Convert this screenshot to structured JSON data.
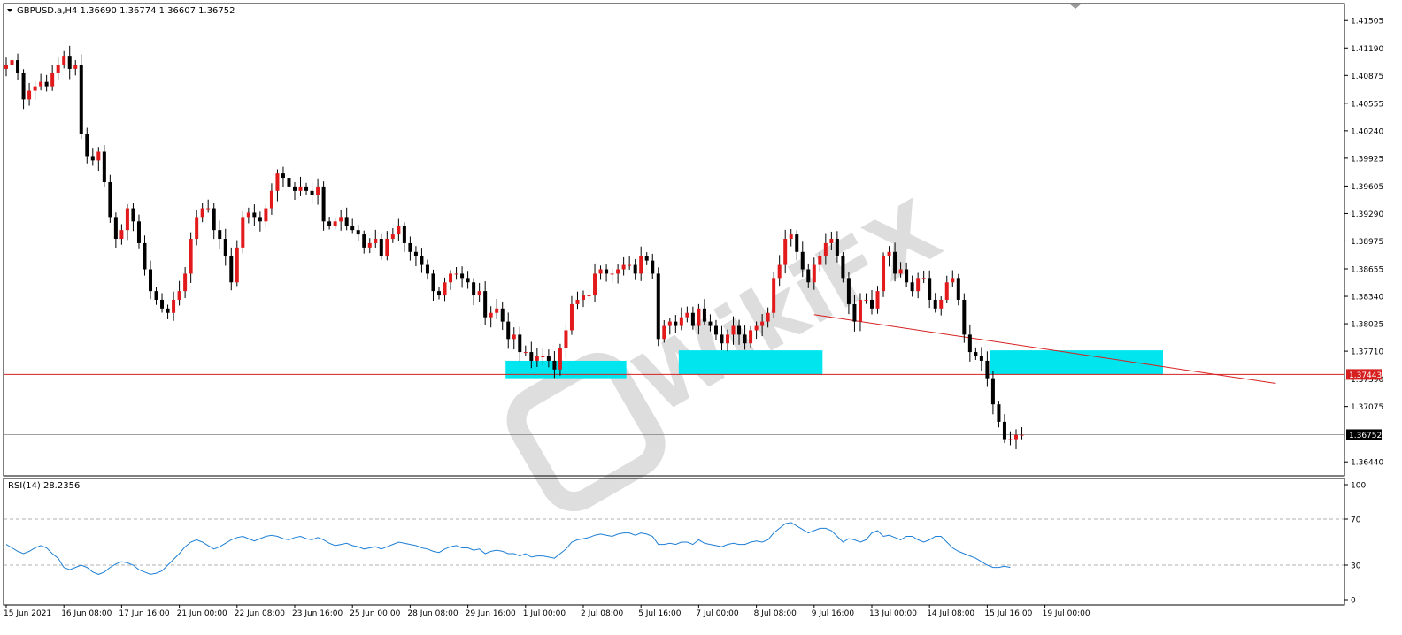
{
  "header": {
    "symbol_line": "GBPUSD.a,H4  1.36690 1.36774 1.36607 1.36752"
  },
  "rsi_panel": {
    "label": "RSI(14) 28.2356",
    "line_color": "#1e7fd6"
  },
  "colors": {
    "bull": "#e31a1c",
    "bear": "#000000",
    "zone": "#00e5ee",
    "hline": "#d62020",
    "trendline": "#d62020",
    "price_tag_bg": "#000000",
    "hline_tag_bg": "#d62020"
  },
  "watermark": {
    "text": "WikiFX",
    "icon": "wikifx-logo-icon"
  },
  "chart_data": [
    {
      "type": "candlestick",
      "symbol": "GBPUSD.a",
      "timeframe": "H4",
      "ohlc_header": {
        "open": 1.3669,
        "high": 1.36774,
        "low": 1.36607,
        "close": 1.36752
      },
      "y_ticks": [
        "1.41505",
        "1.41190",
        "1.40875",
        "1.40555",
        "1.40240",
        "1.39925",
        "1.39605",
        "1.39290",
        "1.38975",
        "1.38655",
        "1.38340",
        "1.38025",
        "1.37710",
        "1.37390",
        "1.37075",
        "1.36752",
        "1.36440"
      ],
      "ylim": [
        1.363,
        1.4168
      ],
      "current_price": {
        "value": 1.36752,
        "label": "1.36752"
      },
      "horizontal_line": {
        "value": 1.37443,
        "label": "1.37443"
      },
      "trendline": {
        "from": {
          "bar": 140,
          "price": 1.3813
        },
        "to": {
          "bar": 220,
          "price": 1.3734
        }
      },
      "zones": [
        {
          "from_bar": 87,
          "to_bar": 107,
          "price_top": 1.376,
          "price_bottom": 1.374
        },
        {
          "from_bar": 117,
          "to_bar": 141,
          "price_top": 1.3772,
          "price_bottom": 1.3744
        },
        {
          "from_bar": 171,
          "to_bar": 200,
          "price_top": 1.3772,
          "price_bottom": 1.3744
        }
      ],
      "x_tick_labels": [
        {
          "bar": 0,
          "label": "15 Jun 2021"
        },
        {
          "bar": 10,
          "label": "16 Jun 08:00"
        },
        {
          "bar": 20,
          "label": "17 Jun 16:00"
        },
        {
          "bar": 30,
          "label": "21 Jun 00:00"
        },
        {
          "bar": 40,
          "label": "22 Jun 08:00"
        },
        {
          "bar": 50,
          "label": "23 Jun 16:00"
        },
        {
          "bar": 60,
          "label": "25 Jun 00:00"
        },
        {
          "bar": 70,
          "label": "28 Jun 08:00"
        },
        {
          "bar": 80,
          "label": "29 Jun 16:00"
        },
        {
          "bar": 90,
          "label": "1 Jul 00:00"
        },
        {
          "bar": 100,
          "label": "2 Jul 08:00"
        },
        {
          "bar": 110,
          "label": "5 Jul 16:00"
        },
        {
          "bar": 120,
          "label": "7 Jul 00:00"
        },
        {
          "bar": 130,
          "label": "8 Jul 08:00"
        },
        {
          "bar": 140,
          "label": "9 Jul 16:00"
        },
        {
          "bar": 150,
          "label": "13 Jul 00:00"
        },
        {
          "bar": 160,
          "label": "14 Jul 08:00"
        },
        {
          "bar": 170,
          "label": "15 Jul 16:00"
        },
        {
          "bar": 180,
          "label": "19 Jul 00:00"
        }
      ],
      "closes": [
        1.41,
        1.4105,
        1.409,
        1.406,
        1.407,
        1.4075,
        1.408,
        1.4075,
        1.409,
        1.41,
        1.411,
        1.4095,
        1.41,
        1.402,
        1.3995,
        1.399,
        1.4,
        1.3965,
        1.3925,
        1.39,
        1.391,
        1.3935,
        1.392,
        1.3895,
        1.3865,
        1.384,
        1.383,
        1.382,
        1.3815,
        1.383,
        1.384,
        1.386,
        1.39,
        1.3925,
        1.3935,
        1.3935,
        1.391,
        1.39,
        1.388,
        1.385,
        1.389,
        1.3925,
        1.393,
        1.3925,
        1.392,
        1.3935,
        1.3955,
        1.3975,
        1.397,
        1.396,
        1.3955,
        1.396,
        1.3955,
        1.395,
        1.396,
        1.392,
        1.3915,
        1.392,
        1.3925,
        1.3915,
        1.391,
        1.3905,
        1.389,
        1.3895,
        1.39,
        1.388,
        1.39,
        1.3905,
        1.3915,
        1.3895,
        1.3885,
        1.388,
        1.387,
        1.386,
        1.384,
        1.3835,
        1.385,
        1.386,
        1.386,
        1.3855,
        1.385,
        1.3835,
        1.384,
        1.381,
        1.3815,
        1.382,
        1.3805,
        1.3785,
        1.379,
        1.377,
        1.377,
        1.376,
        1.3765,
        1.3765,
        1.376,
        1.375,
        1.3775,
        1.3795,
        1.3825,
        1.383,
        1.3835,
        1.3835,
        1.386,
        1.3865,
        1.386,
        1.386,
        1.3865,
        1.387,
        1.387,
        1.386,
        1.388,
        1.3875,
        1.386,
        1.3785,
        1.38,
        1.3805,
        1.38,
        1.381,
        1.3815,
        1.38,
        1.382,
        1.3805,
        1.38,
        1.379,
        1.378,
        1.379,
        1.38,
        1.379,
        1.378,
        1.3795,
        1.38,
        1.3805,
        1.3815,
        1.3855,
        1.387,
        1.39,
        1.3905,
        1.3885,
        1.3865,
        1.385,
        1.387,
        1.388,
        1.3895,
        1.39,
        1.388,
        1.3855,
        1.3825,
        1.3805,
        1.383,
        1.383,
        1.382,
        1.384,
        1.388,
        1.3885,
        1.386,
        1.3865,
        1.385,
        1.384,
        1.3855,
        1.3855,
        1.383,
        1.382,
        1.383,
        1.385,
        1.3855,
        1.383,
        1.379,
        1.377,
        1.3765,
        1.376,
        1.374,
        1.371,
        1.369,
        1.367,
        1.367,
        1.3675,
        1.3675
      ]
    },
    {
      "type": "line",
      "name": "RSI(14) 28.2356",
      "ylim": [
        0,
        100
      ],
      "y_ticks": [
        "100",
        "70",
        "30",
        "0"
      ],
      "reference_levels": [
        70,
        30
      ],
      "values": [
        48,
        45,
        42,
        40,
        42,
        45,
        47,
        45,
        40,
        36,
        28,
        26,
        28,
        30,
        28,
        24,
        22,
        24,
        28,
        31,
        33,
        32,
        30,
        26,
        24,
        22,
        23,
        25,
        30,
        35,
        40,
        46,
        50,
        52,
        50,
        47,
        44,
        46,
        49,
        52,
        54,
        55,
        53,
        51,
        53,
        55,
        56,
        55,
        53,
        52,
        54,
        55,
        53,
        52,
        54,
        52,
        49,
        47,
        48,
        49,
        47,
        46,
        44,
        45,
        46,
        44,
        46,
        48,
        50,
        49,
        48,
        47,
        45,
        44,
        42,
        41,
        44,
        46,
        47,
        45,
        45,
        43,
        44,
        40,
        42,
        43,
        42,
        40,
        40,
        38,
        40,
        37,
        38,
        38,
        37,
        36,
        40,
        44,
        50,
        52,
        53,
        54,
        56,
        57,
        56,
        55,
        57,
        58,
        58,
        56,
        58,
        57,
        55,
        48,
        48,
        49,
        48,
        50,
        50,
        48,
        52,
        49,
        48,
        47,
        46,
        48,
        49,
        48,
        48,
        50,
        51,
        50,
        52,
        58,
        62,
        66,
        67,
        64,
        61,
        58,
        60,
        62,
        62,
        60,
        55,
        50,
        53,
        52,
        50,
        52,
        58,
        60,
        55,
        56,
        54,
        52,
        55,
        55,
        52,
        50,
        52,
        55,
        55,
        50,
        45,
        42,
        40,
        38,
        36,
        33,
        30,
        28,
        28,
        29,
        28
      ]
    }
  ]
}
